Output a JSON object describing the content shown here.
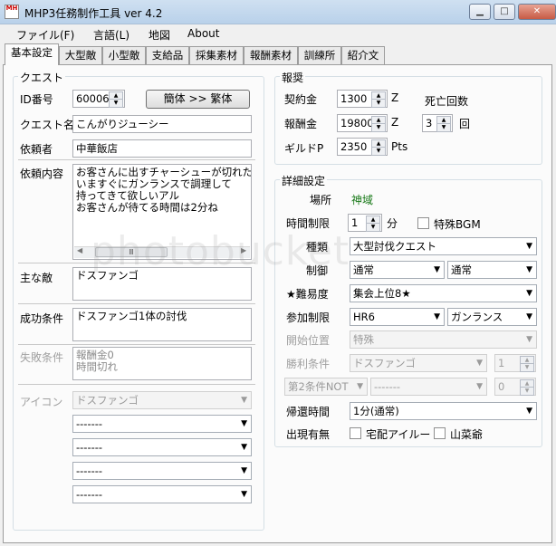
{
  "window": {
    "app_icon_text": "MH",
    "title": "MHP3任務制作工具 ver 4.2",
    "minimize_glyph": "▁",
    "maximize_glyph": "□",
    "close_glyph": "✕"
  },
  "menu": [
    "ファイル(F)",
    "言語(L)",
    "地図",
    "About"
  ],
  "tabs": [
    "基本設定",
    "大型敵",
    "小型敵",
    "支給品",
    "採集素材",
    "報酬素材",
    "訓練所",
    "紹介文"
  ],
  "quest": {
    "group_label": "クエスト",
    "id_label": "ID番号",
    "id_value": "60006",
    "convert_button": "簡体 >> 繁体",
    "name_label": "クエスト名",
    "name_value": "こんがりジューシー",
    "client_label": "依頼者",
    "client_value": "中華飯店",
    "content_label": "依頼内容",
    "content_value": "お客さんに出すチャーシューが切れたネ\nいますぐにガンランスで調理して\n持ってきて欲しいアル\nお客さんが待てる時間は2分ね",
    "scroll_left": "◀",
    "scroll_thumb": "Ⅲ",
    "scroll_right": "▶",
    "main_enemy_label": "主な敵",
    "main_enemy_value": "ドスファンゴ",
    "success_label": "成功条件",
    "success_value": "ドスファンゴ1体の討伐",
    "failure_label": "失敗条件",
    "failure_value": "報酬金0\n時間切れ",
    "icon_label": "アイコン",
    "icon_selects": [
      "ドスファンゴ",
      "-------",
      "-------",
      "-------",
      "-------"
    ]
  },
  "reward": {
    "group_label": "報奨",
    "contract_label": "契約金",
    "contract_value": "1300",
    "contract_unit": "Z",
    "reward_label": "報酬金",
    "reward_value": "19800",
    "reward_unit": "Z",
    "guild_label": "ギルドP",
    "guild_value": "2350",
    "guild_unit": "Pts",
    "death_label": "死亡回数",
    "death_value": "3",
    "death_unit": "回"
  },
  "detail": {
    "group_label": "詳細設定",
    "place_label": "場所",
    "place_value": "神域",
    "time_label": "時間制限",
    "time_value": "1",
    "time_unit": "分",
    "bgm_label": "特殊BGM",
    "type_label": "種類",
    "type_value": "大型討伐クエスト",
    "control_label": "制御",
    "control_value1": "通常",
    "control_value2": "通常",
    "difficulty_label": "★難易度",
    "difficulty_value": "集会上位8★",
    "entry_label": "参加制限",
    "entry_value1": "HR6",
    "entry_value2": "ガンランス",
    "start_label": "開始位置",
    "start_value": "特殊",
    "win_label": "勝利条件",
    "win_value": "ドスファンゴ",
    "win_count": "1",
    "cond2_value": "第2条件NOT",
    "cond2_target": "-------",
    "cond2_count": "0",
    "return_label": "帰還時間",
    "return_value": "1分(通常)",
    "appear_label": "出現有無",
    "felyne_label": "宅配アイルー",
    "grandpa_label": "山菜爺"
  },
  "watermark": "photobucket",
  "icons": {
    "combo_arrow": "▼",
    "spin_up": "▲",
    "spin_down": "▼"
  }
}
